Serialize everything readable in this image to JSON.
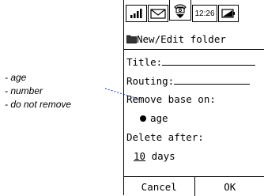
{
  "annotation": {
    "notes": [
      "- age",
      "- number",
      "- do not remove"
    ]
  },
  "statusbar": {
    "signal_icon": "signal-bars-icon",
    "message_icon": "envelope-icon",
    "phone_icon": "telephone-icon",
    "time": "12:26",
    "battery_icon": "battery-icon"
  },
  "screen": {
    "title": "New/Edit folder",
    "title_icon": "folder-icon",
    "title_field_label": "Title:",
    "routing_field_label": "Routing:",
    "remove_label": "Remove base on:",
    "remove_selected": "age",
    "delete_label": "Delete after:",
    "delete_amount": "10",
    "delete_unit": "days"
  },
  "buttons": {
    "cancel": "Cancel",
    "ok": "OK"
  }
}
